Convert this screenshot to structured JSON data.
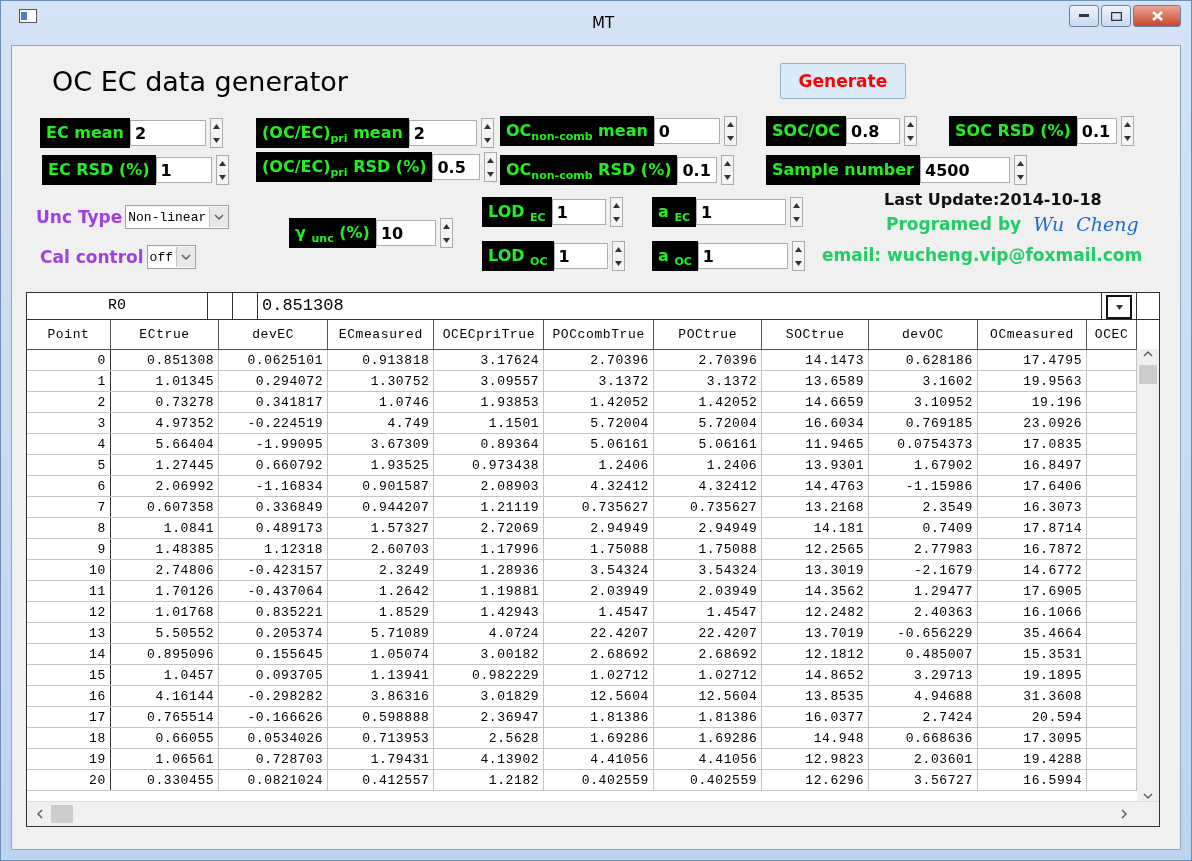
{
  "window": {
    "title": "MT"
  },
  "app_title": "OC EC data generator",
  "generate_button": "Generate",
  "ec_params": [
    {
      "label": "EC mean",
      "value": "2"
    },
    {
      "label": "EC RSD (%)",
      "value": "1"
    }
  ],
  "pri_params": [
    {
      "label": "(OC/EC)$_{pri}$ mean",
      "value": "2"
    },
    {
      "label": "(OC/EC)$_{pri}$  RSD (%)",
      "value": "0.5"
    }
  ],
  "noncomb_params": [
    {
      "label": "OC$_{non-comb}$ mean",
      "value": "0"
    },
    {
      "label": "OC$_{non-comb}$ RSD (%)",
      "value": "0.1"
    }
  ],
  "soc_params": [
    {
      "label": "SOC/OC",
      "value": "0.8"
    },
    {
      "label": "SOC RSD (%)",
      "value": "0.1"
    },
    {
      "label": "Sample number",
      "value": "4500"
    }
  ],
  "gamma_param": {
    "label": "γ $_{unc}$  (%)",
    "value": "10"
  },
  "lod_params": [
    {
      "label": "LOD $_{EC}$",
      "value": "1"
    },
    {
      "label": "a $_{EC}$",
      "value": "1"
    },
    {
      "label": "LOD $_{OC}$",
      "value": "1"
    },
    {
      "label": "a $_{OC}$",
      "value": "1"
    }
  ],
  "unc_type": {
    "label": "Unc Type",
    "value": "Non-linear"
  },
  "cal_control": {
    "label": "Cal control",
    "value": "off"
  },
  "last_update": "Last Update:2014-10-18",
  "programmed_by": {
    "label": "Programed by",
    "author": "Wu  Cheng"
  },
  "email": "email: wucheng.vip@foxmail.com",
  "grid": {
    "cell_ref": "R0",
    "cell_value": "0.851308",
    "columns": [
      "Point",
      "ECtrue",
      "devEC",
      "ECmeasured",
      "OCECpriTrue",
      "POCcombTrue",
      "POCtrue",
      "SOCtrue",
      "devOC",
      "OCmeasured",
      "OCEC"
    ],
    "rows": [
      [
        "0",
        "0.851308",
        "0.0625101",
        "0.913818",
        "3.17624",
        "2.70396",
        "2.70396",
        "14.1473",
        "0.628186",
        "17.4795"
      ],
      [
        "1",
        "1.01345",
        "0.294072",
        "1.30752",
        "3.09557",
        "3.1372",
        "3.1372",
        "13.6589",
        "3.1602",
        "19.9563"
      ],
      [
        "2",
        "0.73278",
        "0.341817",
        "1.0746",
        "1.93853",
        "1.42052",
        "1.42052",
        "14.6659",
        "3.10952",
        "19.196"
      ],
      [
        "3",
        "4.97352",
        "-0.224519",
        "4.749",
        "1.1501",
        "5.72004",
        "5.72004",
        "16.6034",
        "0.769185",
        "23.0926"
      ],
      [
        "4",
        "5.66404",
        "-1.99095",
        "3.67309",
        "0.89364",
        "5.06161",
        "5.06161",
        "11.9465",
        "0.0754373",
        "17.0835"
      ],
      [
        "5",
        "1.27445",
        "0.660792",
        "1.93525",
        "0.973438",
        "1.2406",
        "1.2406",
        "13.9301",
        "1.67902",
        "16.8497"
      ],
      [
        "6",
        "2.06992",
        "-1.16834",
        "0.901587",
        "2.08903",
        "4.32412",
        "4.32412",
        "14.4763",
        "-1.15986",
        "17.6406"
      ],
      [
        "7",
        "0.607358",
        "0.336849",
        "0.944207",
        "1.21119",
        "0.735627",
        "0.735627",
        "13.2168",
        "2.3549",
        "16.3073"
      ],
      [
        "8",
        "1.0841",
        "0.489173",
        "1.57327",
        "2.72069",
        "2.94949",
        "2.94949",
        "14.181",
        "0.7409",
        "17.8714"
      ],
      [
        "9",
        "1.48385",
        "1.12318",
        "2.60703",
        "1.17996",
        "1.75088",
        "1.75088",
        "12.2565",
        "2.77983",
        "16.7872"
      ],
      [
        "10",
        "2.74806",
        "-0.423157",
        "2.3249",
        "1.28936",
        "3.54324",
        "3.54324",
        "13.3019",
        "-2.1679",
        "14.6772"
      ],
      [
        "11",
        "1.70126",
        "-0.437064",
        "1.2642",
        "1.19881",
        "2.03949",
        "2.03949",
        "14.3562",
        "1.29477",
        "17.6905"
      ],
      [
        "12",
        "1.01768",
        "0.835221",
        "1.8529",
        "1.42943",
        "1.4547",
        "1.4547",
        "12.2482",
        "2.40363",
        "16.1066"
      ],
      [
        "13",
        "5.50552",
        "0.205374",
        "5.71089",
        "4.0724",
        "22.4207",
        "22.4207",
        "13.7019",
        "-0.656229",
        "35.4664"
      ],
      [
        "14",
        "0.895096",
        "0.155645",
        "1.05074",
        "3.00182",
        "2.68692",
        "2.68692",
        "12.1812",
        "0.485007",
        "15.3531"
      ],
      [
        "15",
        "1.0457",
        "0.093705",
        "1.13941",
        "0.982229",
        "1.02712",
        "1.02712",
        "14.8652",
        "3.29713",
        "19.1895"
      ],
      [
        "16",
        "4.16144",
        "-0.298282",
        "3.86316",
        "3.01829",
        "12.5604",
        "12.5604",
        "13.8535",
        "4.94688",
        "31.3608"
      ],
      [
        "17",
        "0.765514",
        "-0.166626",
        "0.598888",
        "2.36947",
        "1.81386",
        "1.81386",
        "16.0377",
        "2.7424",
        "20.594"
      ],
      [
        "18",
        "0.66055",
        "0.0534026",
        "0.713953",
        "2.5628",
        "1.69286",
        "1.69286",
        "14.948",
        "0.668636",
        "17.3095"
      ],
      [
        "19",
        "1.06561",
        "0.728703",
        "1.79431",
        "4.13902",
        "4.41056",
        "4.41056",
        "12.9823",
        "2.03601",
        "19.4288"
      ],
      [
        "20",
        "0.330455",
        "0.0821024",
        "0.412557",
        "1.2182",
        "0.402559",
        "0.402559",
        "12.6296",
        "3.56727",
        "16.5994"
      ]
    ]
  }
}
